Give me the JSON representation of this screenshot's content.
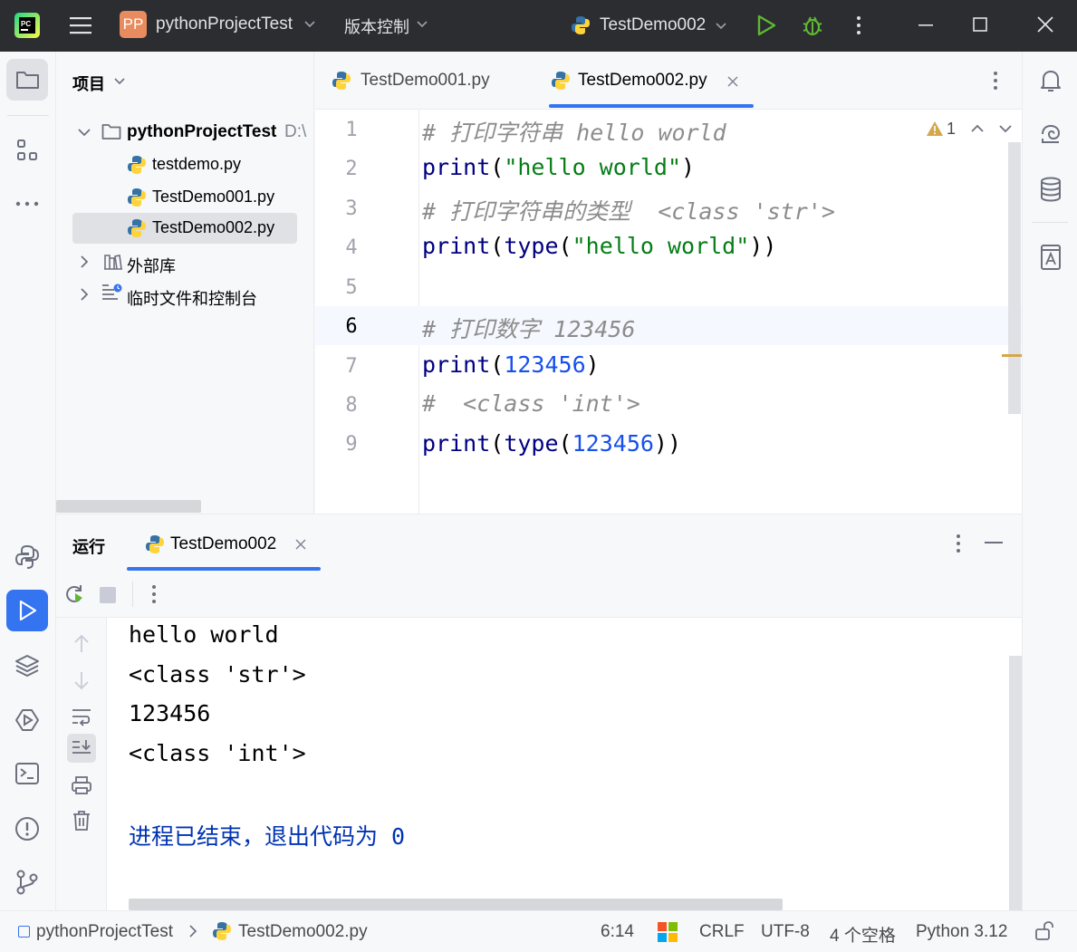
{
  "titlebar": {
    "project_badge": "PP",
    "project_name": "pythonProjectTest",
    "vcs_menu": "版本控制",
    "run_config": "TestDemo002"
  },
  "project_panel": {
    "title": "项目",
    "root_name": "pythonProjectTest",
    "root_path": "D:\\",
    "files": [
      "testdemo.py",
      "TestDemo001.py",
      "TestDemo002.py"
    ],
    "external_libs": "外部库",
    "scratches": "临时文件和控制台"
  },
  "editor": {
    "tabs": [
      {
        "label": "TestDemo001.py",
        "active": false
      },
      {
        "label": "TestDemo002.py",
        "active": true
      }
    ],
    "warning_count": "1",
    "current_line": "6",
    "line_numbers": [
      "1",
      "2",
      "3",
      "4",
      "5",
      "6",
      "7",
      "8",
      "9"
    ],
    "code": {
      "l1": "# 打印字符串 hello world",
      "l2_fn": "print",
      "l2_open": "(",
      "l2_str": "\"hello world\"",
      "l2_close": ")",
      "l3": "# 打印字符串的类型  <class 'str'>",
      "l4_fn": "print",
      "l4_open": "(",
      "l4_fn2": "type",
      "l4_open2": "(",
      "l4_str": "\"hello world\"",
      "l4_close": "))",
      "l6": "# 打印数字 123456",
      "l7_fn": "print",
      "l7_open": "(",
      "l7_num": "123456",
      "l7_close": ")",
      "l8": "#  <class 'int'>",
      "l9_fn": "print",
      "l9_open": "(",
      "l9_fn2": "type",
      "l9_open2": "(",
      "l9_num": "123456",
      "l9_close": "))"
    }
  },
  "run_panel": {
    "title": "运行",
    "tab_label": "TestDemo002",
    "output": [
      "hello world",
      "<class 'str'>",
      "123456",
      "<class 'int'>"
    ],
    "exit_message": "进程已结束，退出代码为 0"
  },
  "statusbar": {
    "breadcrumb_project": "pythonProjectTest",
    "breadcrumb_file": "TestDemo002.py",
    "position": "6:14",
    "line_ending": "CRLF",
    "encoding": "UTF-8",
    "indent": "4 个空格",
    "interpreter": "Python 3.12"
  },
  "colors": {
    "accent": "#3574f0",
    "title_bg": "#2b2d30",
    "run_green": "#5fb832",
    "project_badge": "#e88b5e"
  }
}
